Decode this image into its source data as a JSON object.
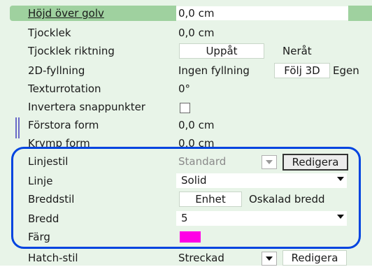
{
  "rows": [
    {
      "label": "Höjd över golv",
      "value": "0,0 cm"
    },
    {
      "label": "Tjocklek",
      "value": "0,0 cm"
    },
    {
      "label": "Tjocklek riktning",
      "options": [
        "Uppåt",
        "Neråt"
      ]
    },
    {
      "label": "2D-fyllning",
      "options": [
        "Ingen fyllning",
        "Följ 3D",
        "Egen"
      ]
    },
    {
      "label": "Texturrotation",
      "value": "0°"
    },
    {
      "label": "Invertera snappunkter"
    },
    {
      "label": "Förstora form",
      "value": "0,0 cm"
    },
    {
      "label": "Krymp form",
      "value": "0,0 cm"
    },
    {
      "label": "Linjestil",
      "value": "Standard",
      "button": "Redigera"
    },
    {
      "label": "Linje",
      "value": "Solid"
    },
    {
      "label": "Breddstil",
      "options": [
        "Enhet",
        "Oskalad bredd"
      ]
    },
    {
      "label": "Bredd",
      "value": "5"
    },
    {
      "label": "Färg"
    },
    {
      "label": "Hatch-stil",
      "value": "Streckad",
      "button": "Redigera"
    }
  ],
  "colors": {
    "highlight": "#9fd19f",
    "panel": "#e8f4e8",
    "swatch": "#ff00e6",
    "annotation": "#0044e0"
  }
}
